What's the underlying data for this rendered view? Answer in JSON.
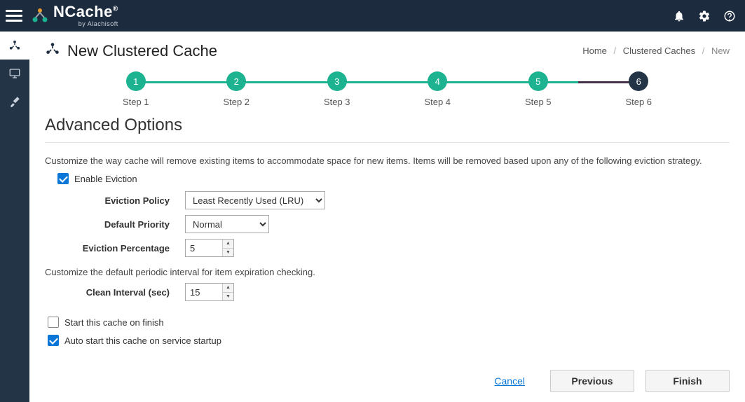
{
  "brand": {
    "name": "NCache",
    "byline": "by Alachisoft",
    "reg": "®"
  },
  "page": {
    "title": "New Clustered Cache",
    "section_title": "Advanced Options",
    "description": "Customize the way cache will remove existing items to accommodate space for new items. Items will be removed based upon any of the following eviction strategy.",
    "clean_interval_desc": "Customize the default periodic interval for item expiration checking."
  },
  "breadcrumb": {
    "home": "Home",
    "mid": "Clustered Caches",
    "current": "New"
  },
  "stepper": {
    "steps": [
      {
        "num": "1",
        "label": "Step 1"
      },
      {
        "num": "2",
        "label": "Step 2"
      },
      {
        "num": "3",
        "label": "Step 3"
      },
      {
        "num": "4",
        "label": "Step 4"
      },
      {
        "num": "5",
        "label": "Step 5"
      },
      {
        "num": "6",
        "label": "Step 6"
      }
    ]
  },
  "form": {
    "enable_eviction_label": "Enable Eviction",
    "eviction_policy_label": "Eviction Policy",
    "eviction_policy_value": "Least Recently Used (LRU)",
    "default_priority_label": "Default Priority",
    "default_priority_value": "Normal",
    "eviction_percentage_label": "Eviction Percentage",
    "eviction_percentage_value": "5",
    "clean_interval_label": "Clean Interval (sec)",
    "clean_interval_value": "15",
    "start_on_finish_label": "Start this cache on finish",
    "auto_start_label": "Auto start this cache on service startup"
  },
  "footer": {
    "cancel": "Cancel",
    "previous": "Previous",
    "finish": "Finish"
  }
}
